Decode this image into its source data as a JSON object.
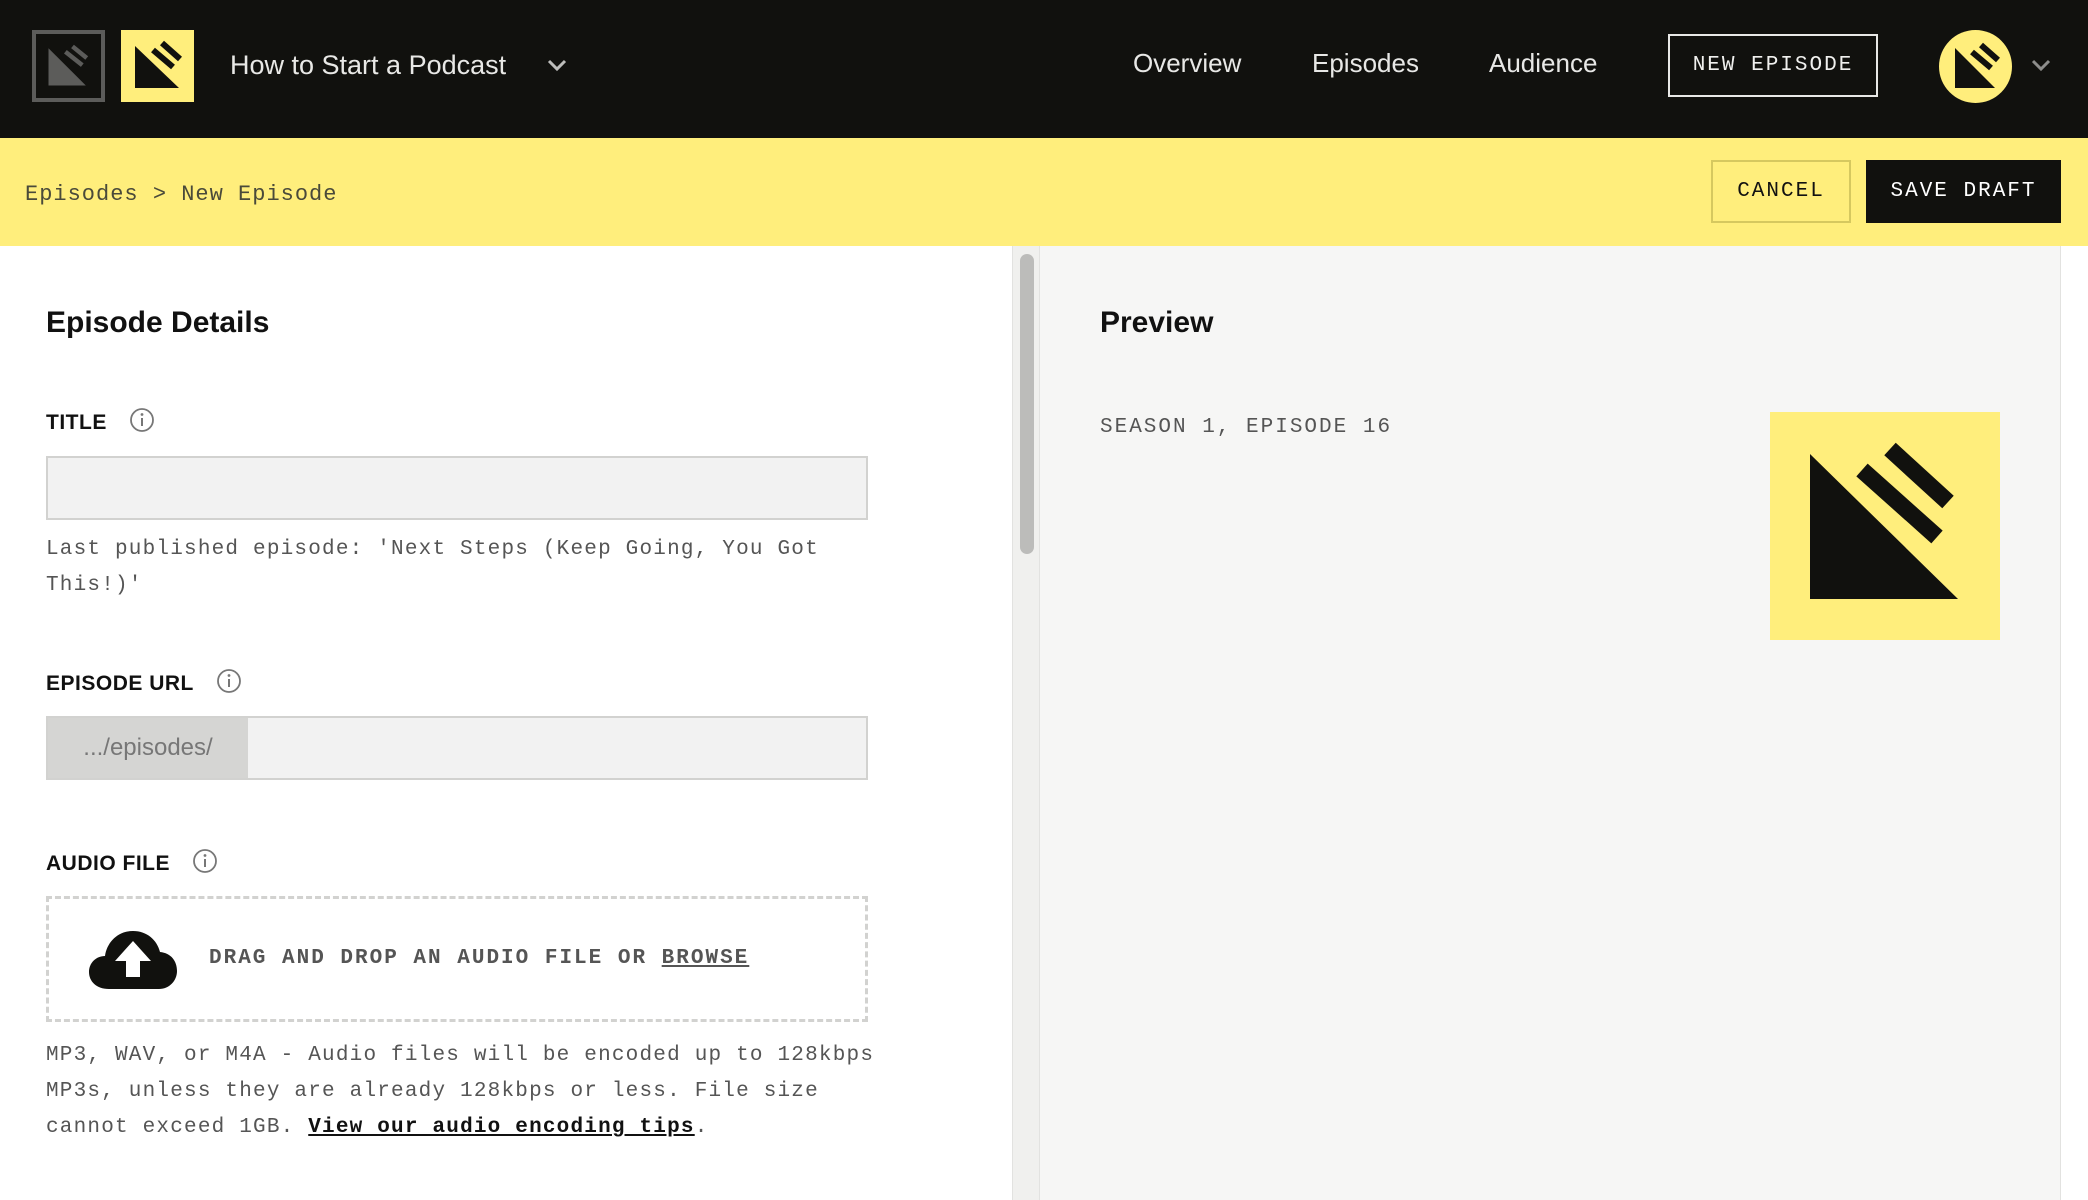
{
  "header": {
    "show_title": "How to Start a Podcast",
    "nav": {
      "overview": "Overview",
      "episodes": "Episodes",
      "audience": "Audience"
    },
    "new_episode_label": "NEW EPISODE"
  },
  "subbar": {
    "breadcrumb": {
      "parent": "Episodes",
      "separator": ">",
      "current": "New Episode"
    },
    "cancel_label": "CANCEL",
    "save_draft_label": "SAVE DRAFT"
  },
  "form": {
    "section_title": "Episode Details",
    "title": {
      "label": "TITLE",
      "value": "",
      "hint": "Last published episode: 'Next Steps (Keep Going, You Got This!)'"
    },
    "episode_url": {
      "label": "EPISODE URL",
      "prefix": ".../episodes/",
      "value": ""
    },
    "audio_file": {
      "label": "AUDIO FILE",
      "drop_text": "DRAG AND DROP AN AUDIO FILE OR",
      "browse_label": "BROWSE",
      "hint": "MP3, WAV, or M4A - Audio files will be encoded up to 128kbps MP3s, unless they are already 128kbps or less. File size cannot exceed 1GB.",
      "tips_link": "View our audio encoding tips",
      "hint_end": "."
    }
  },
  "preview": {
    "section_title": "Preview",
    "season_episode": "SEASON 1, EPISODE 16"
  },
  "icons": {
    "logo": "podcast-logo-icon",
    "chevron": "chevron-down-icon",
    "info": "info-icon",
    "upload": "cloud-upload-icon"
  },
  "colors": {
    "topbar": "#11110e",
    "accent_yellow": "#ffee7c",
    "input_bg": "#f2f2f2",
    "preview_bg": "#f6f6f5"
  }
}
